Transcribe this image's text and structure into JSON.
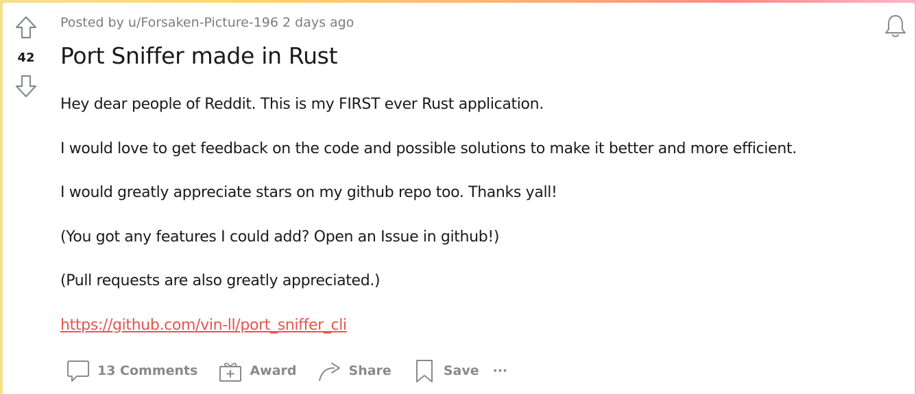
{
  "post": {
    "score": "42",
    "posted_by_prefix": "Posted by",
    "author": "u/Forsaken-Picture-196",
    "time": "2 days ago",
    "title": "Port Sniffer made in Rust",
    "body": [
      "Hey dear people of Reddit. This is my FIRST ever Rust application.",
      "I would love to get feedback on the code and possible solutions to make it better and more efficient.",
      "I would greatly appreciate stars on my github repo too. Thanks yall!",
      "(You got any features I could add? Open an Issue in github!)",
      "(Pull requests are also greatly appreciated.)"
    ],
    "link": "https://github.com/vin-ll/port_sniffer_cli"
  },
  "actions": {
    "comments": "13 Comments",
    "award": "Award",
    "share": "Share",
    "save": "Save",
    "more": "···"
  },
  "icons": {
    "upvote": "upvote-arrow-icon",
    "downvote": "downvote-arrow-icon",
    "bell": "bell-icon",
    "comment": "comment-bubble-icon",
    "award": "gift-icon",
    "share": "share-arrow-icon",
    "save": "bookmark-icon"
  },
  "colors": {
    "link": "#e8534c",
    "muted": "#878a8c",
    "text": "#1a1a1b"
  }
}
